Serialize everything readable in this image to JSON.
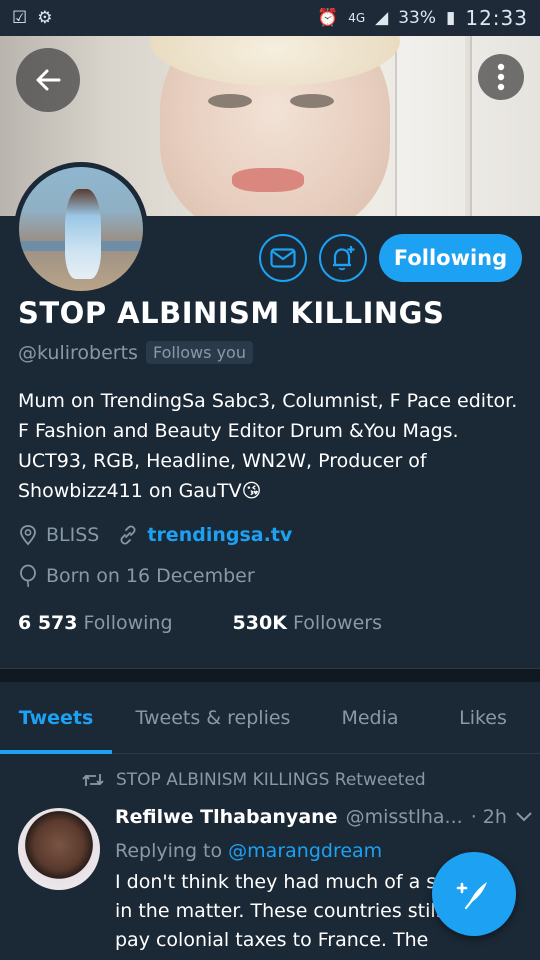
{
  "status_bar": {
    "time": "12:33",
    "battery": "33%",
    "network": "4G"
  },
  "header": {
    "back_icon": "back-arrow-icon",
    "more_icon": "more-vertical-icon"
  },
  "profile": {
    "name": "STOP ALBINISM KILLINGS",
    "handle": "@kuliroberts",
    "follows_you": "Follows you",
    "bio": "Mum on TrendingSa Sabc3, Columnist,  F Pace editor. F Fashion and Beauty Editor  Drum &You Mags. UCT93, RGB, Headline, WN2W,  Producer of Showbizz411 on GauTV😘",
    "location": "BLISS",
    "website": "trendingsa.tv",
    "born": "Born on 16 December",
    "following_count": "6 573",
    "following_label": "Following",
    "followers_count": "530K",
    "followers_label": "Followers",
    "follow_button": "Following"
  },
  "tabs": [
    {
      "label": "Tweets",
      "active": true
    },
    {
      "label": "Tweets & replies",
      "active": false
    },
    {
      "label": "Media",
      "active": false
    },
    {
      "label": "Likes",
      "active": false
    }
  ],
  "tweet": {
    "retweet_label": "STOP ALBINISM KILLINGS Retweeted",
    "author_name": "Refilwe Tlhabanyane",
    "author_handle": "@misstlha...",
    "time": "· 2h",
    "replying_prefix": "Replying to",
    "replying_mention": "@marangdream",
    "text": "I don't think they had much of a say in the matter. These countries still pay colonial taxes to France. The word"
  },
  "colors": {
    "background": "#1b2836",
    "accent": "#1da1f2",
    "secondary_text": "#8899a6"
  }
}
